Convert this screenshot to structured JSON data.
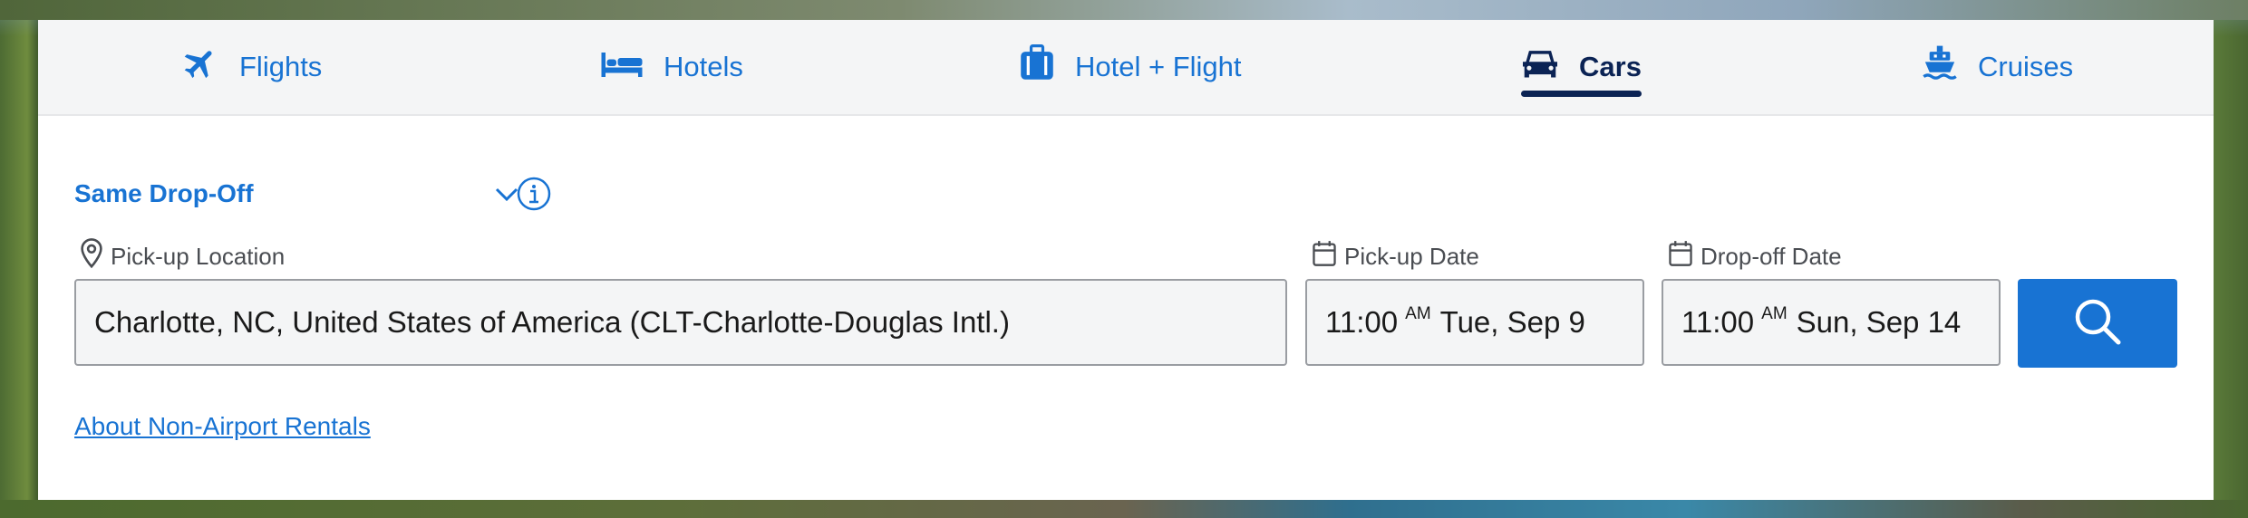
{
  "tabs": [
    {
      "label": "Flights",
      "icon": "airplane-icon"
    },
    {
      "label": "Hotels",
      "icon": "bed-icon"
    },
    {
      "label": "Hotel + Flight",
      "icon": "luggage-icon"
    },
    {
      "label": "Cars",
      "icon": "car-icon",
      "active": true
    },
    {
      "label": "Cruises",
      "icon": "ship-icon"
    }
  ],
  "dropoff_select": {
    "value": "Same Drop-Off",
    "icon": "chevron-down-icon"
  },
  "info": {
    "icon": "info-icon"
  },
  "pickup_location": {
    "label": "Pick-up Location",
    "icon": "map-pin-icon",
    "value": "Charlotte, NC, United States of America (CLT-Charlotte-Douglas Intl.)"
  },
  "pickup_date": {
    "label": "Pick-up Date",
    "icon": "calendar-icon",
    "time": "11:00",
    "ampm": "AM",
    "date": "Tue, Sep 9"
  },
  "dropoff_date": {
    "label": "Drop-off Date",
    "icon": "calendar-icon",
    "time": "11:00",
    "ampm": "AM",
    "date": "Sun, Sep 14"
  },
  "search_button": {
    "icon": "search-icon"
  },
  "non_airport_link": "About Non-Airport Rentals",
  "colors": {
    "accent": "#1873d3",
    "active_tab": "#0b2354"
  }
}
